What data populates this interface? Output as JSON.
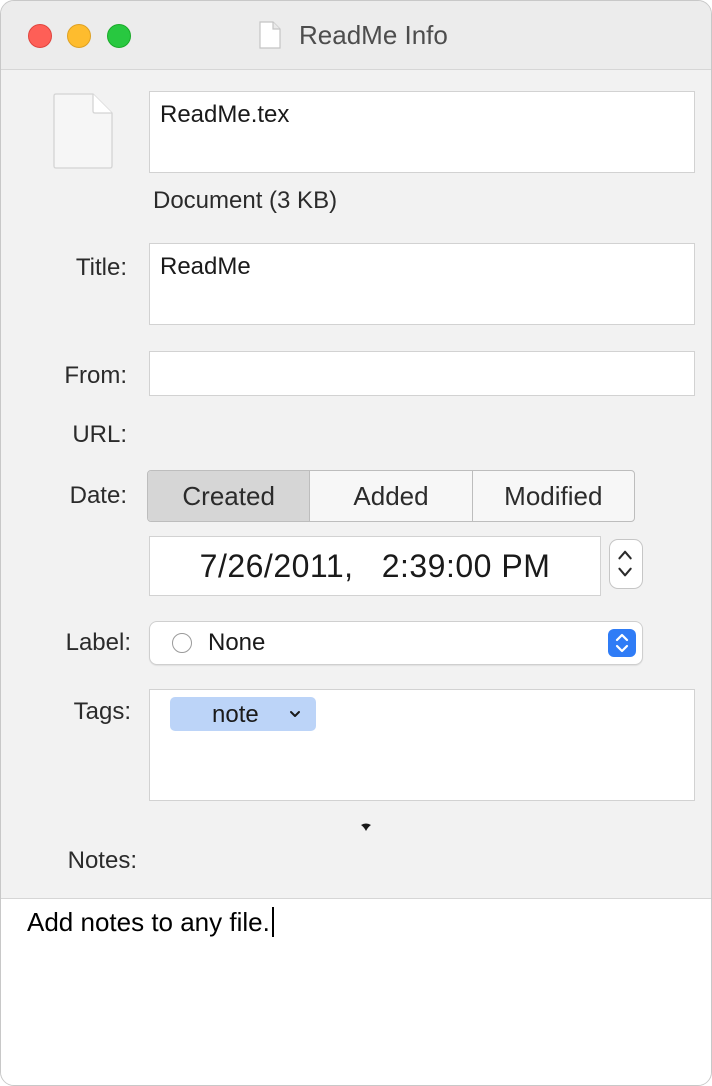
{
  "window": {
    "title": "ReadMe Info"
  },
  "icons": {
    "window_doc": "document-icon",
    "file_preview": "document-icon",
    "label_radio": "circle-icon",
    "popup_arrows": "up-down-chevron-icon",
    "stepper": "up-down-chevron-icon",
    "tag_chevron": "chevron-down-icon"
  },
  "colors": {
    "close": "#fe5f57",
    "minimize": "#febc2e",
    "maximize": "#28c840",
    "accent": "#2f7cf6",
    "tag": "#bcd4f8"
  },
  "file": {
    "name": "ReadMe.tex",
    "kind": "Document (3 KB)"
  },
  "labels": {
    "title": "Title:",
    "from": "From:",
    "url": "URL:",
    "date": "Date:",
    "label": "Label:",
    "tags": "Tags:",
    "notes": "Notes:"
  },
  "fields": {
    "title": "ReadMe",
    "from": "",
    "url": ""
  },
  "date": {
    "segments": [
      "Created",
      "Added",
      "Modified"
    ],
    "selected": "Created",
    "value": "7/26/2011,   2:39:00 PM"
  },
  "label_popup": {
    "value": "None"
  },
  "tags": [
    {
      "name": "note"
    }
  ],
  "notes": {
    "text": "Add notes to any file."
  }
}
